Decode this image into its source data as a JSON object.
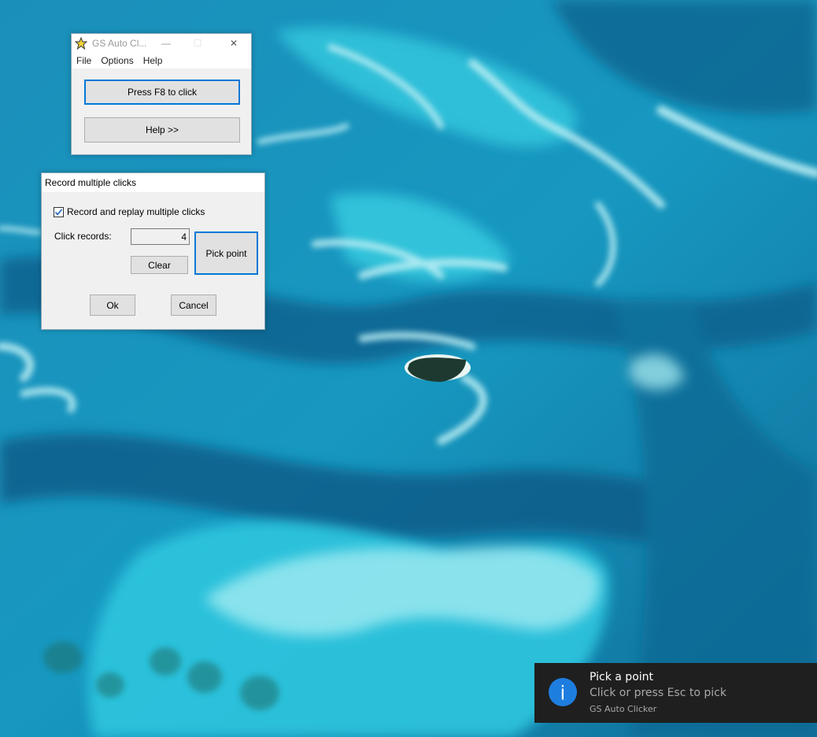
{
  "desktop": {
    "wallpaper": "aerial-ocean-sandbars",
    "colors": {
      "deep": "#0b5f8a",
      "mid": "#1aa0c4",
      "shallow": "#3fd0e4",
      "sand": "#bff2f6",
      "island": "#1d3a2e"
    }
  },
  "app_window": {
    "title": "GS Auto Cl...",
    "icon": "star-icon",
    "controls": {
      "minimize": "—",
      "maximize": "☐",
      "close": "✕"
    },
    "menu": [
      {
        "label": "File"
      },
      {
        "label": "Options"
      },
      {
        "label": "Help"
      }
    ],
    "buttons": {
      "primary": "Press F8 to click",
      "help": "Help >>"
    }
  },
  "dialog": {
    "title": "Record multiple clicks",
    "checkbox": {
      "label": "Record and replay multiple clicks",
      "checked": true
    },
    "click_records_label": "Click records:",
    "click_records_value": "4",
    "buttons": {
      "clear": "Clear",
      "pick_point": "Pick point",
      "ok": "Ok",
      "cancel": "Cancel"
    }
  },
  "toast": {
    "icon": "info-icon",
    "title": "Pick a point",
    "body": "Click or press Esc to pick",
    "source": "GS Auto Clicker",
    "accent": "#1e7ee0"
  }
}
